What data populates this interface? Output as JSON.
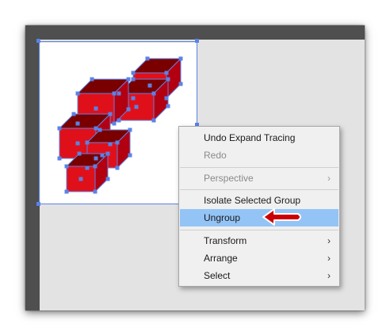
{
  "canvas": {
    "description_icon": "grouped-red-cubes-artwork",
    "colors": {
      "cube": "#e0101a",
      "cube_top": "#7a0000",
      "selection": "#5b82e6"
    }
  },
  "context_menu": {
    "items": [
      {
        "label": "Undo Expand Tracing",
        "disabled": false
      },
      {
        "label": "Redo",
        "disabled": true
      },
      {
        "label": "Perspective",
        "disabled": true,
        "submenu": true
      },
      {
        "label": "Isolate Selected Group",
        "disabled": false
      },
      {
        "label": "Ungroup",
        "disabled": false,
        "highlighted": true
      },
      {
        "label": "Transform",
        "disabled": false,
        "submenu": true
      },
      {
        "label": "Arrange",
        "disabled": false,
        "submenu": true
      },
      {
        "label": "Select",
        "disabled": false,
        "submenu": true
      }
    ],
    "submenu_glyph": "›",
    "highlight_color": "#94c4f6"
  },
  "annotation": {
    "arrow_color": "#cc0000",
    "points_to": "Ungroup"
  }
}
